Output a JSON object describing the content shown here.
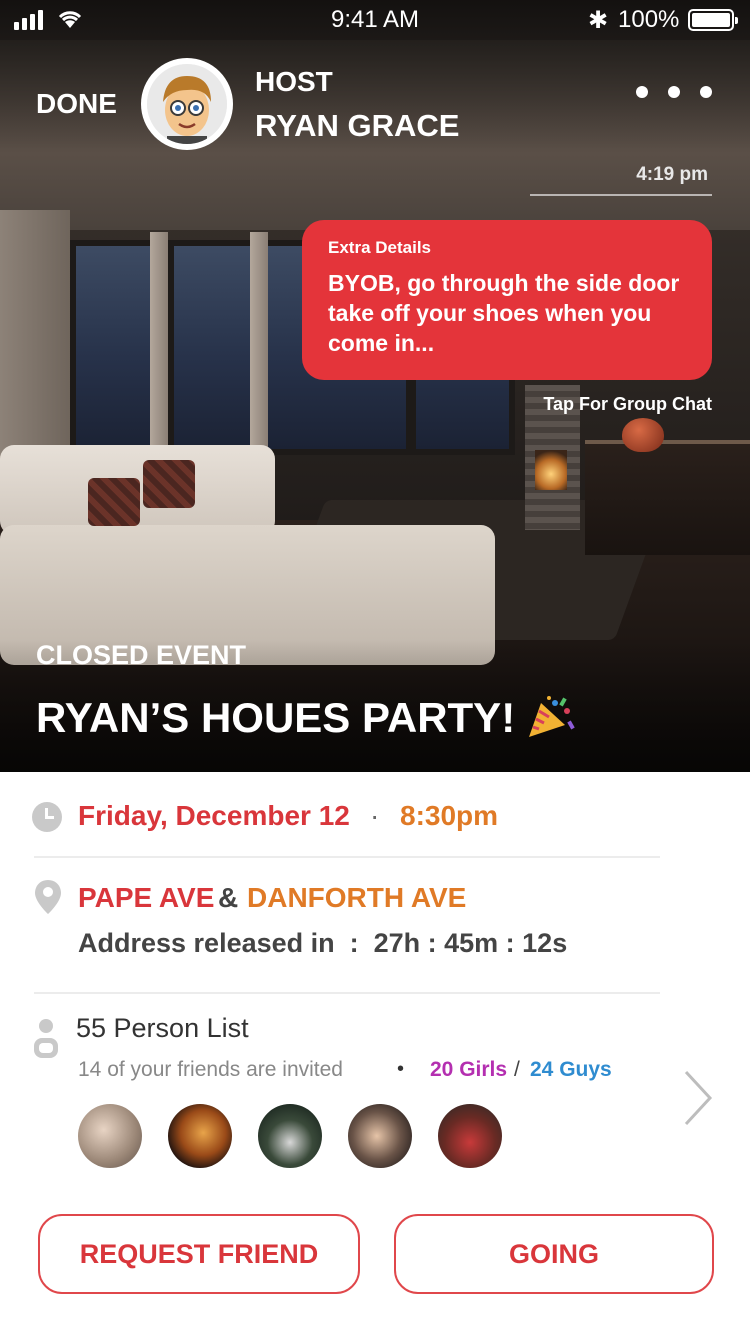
{
  "status_bar": {
    "time": "9:41 AM",
    "battery": "100%"
  },
  "header": {
    "done_label": "DONE",
    "host_label": "HOST",
    "host_name": "RYAN GRACE"
  },
  "message": {
    "time": "4:19 pm",
    "title": "Extra Details",
    "body": "BYOB, go through the side door take off your shoes when you come in...",
    "group_chat_label": "Tap For Group Chat"
  },
  "event": {
    "status": "CLOSED EVENT",
    "title": "RYAN’S HOUES PARTY!",
    "date": "Friday, December 12",
    "separator": "·",
    "time": "8:30pm",
    "street_1": "PAPE AVE",
    "street_joiner": "&",
    "street_2": "DANFORTH AVE",
    "address_release": "Address released in  :  27h : 45m : 12s"
  },
  "guests": {
    "list_title": "55 Person List",
    "friends_invited": "14 of your friends are invited",
    "bullet": "•",
    "girls": "20 Girls",
    "slash": "/",
    "guys": "24 Guys"
  },
  "actions": {
    "request_friend": "REQUEST FRIEND",
    "going": "GOING"
  },
  "icons": [
    "signal-icon",
    "wifi-icon",
    "bluetooth-icon",
    "battery-icon",
    "more-icon",
    "clock-icon",
    "location-pin-icon",
    "person-icon",
    "chevron-right-icon",
    "party-popper-icon"
  ],
  "colors": {
    "accent_red": "#d9363b",
    "accent_orange": "#e07a26",
    "girls": "#b42fb0",
    "guys": "#2f8cd0",
    "bubble": "#e4343a"
  }
}
